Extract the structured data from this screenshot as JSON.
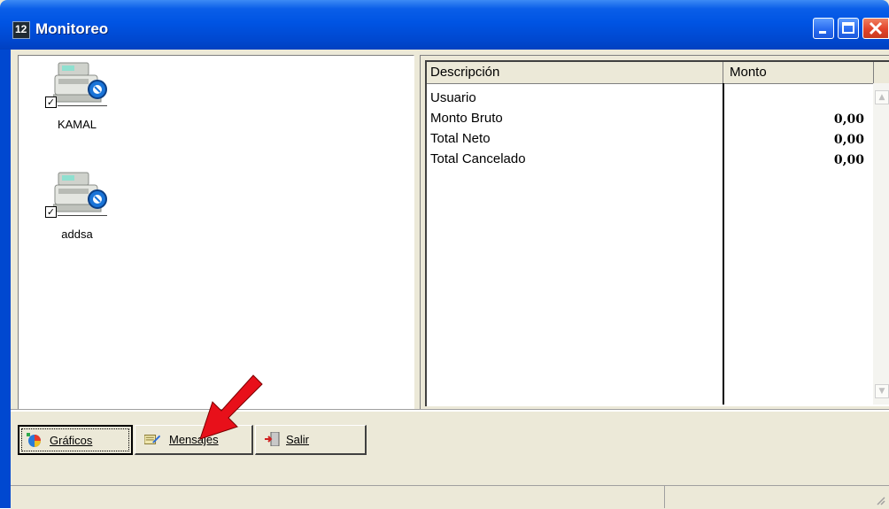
{
  "window": {
    "title": "Monitoreo",
    "icon": "app-icon",
    "controls": {
      "minimize": "_",
      "maximize": "□",
      "close": "X"
    }
  },
  "terminals": [
    {
      "name": "KAMAL",
      "checked": true,
      "icon": "cash-register-icon"
    },
    {
      "name": "addsa",
      "checked": true,
      "icon": "cash-register-icon"
    }
  ],
  "grid": {
    "columns": [
      "Descripción",
      "Monto"
    ],
    "rows": [
      {
        "description": "Usuario",
        "amount": ""
      },
      {
        "description": "Monto Bruto",
        "amount": "0,00"
      },
      {
        "description": "Total Neto",
        "amount": "0,00"
      },
      {
        "description": "Total Cancelado",
        "amount": "0,00"
      }
    ]
  },
  "buttons": {
    "graficos": {
      "label": "Gráficos",
      "icon": "chart-icon"
    },
    "mensajes": {
      "label": "Mensajes",
      "icon": "message-icon"
    },
    "salir": {
      "label": "Salir",
      "icon": "exit-door-icon"
    }
  },
  "annotation": {
    "icon": "red-arrow-icon",
    "color": "#e8101a"
  }
}
